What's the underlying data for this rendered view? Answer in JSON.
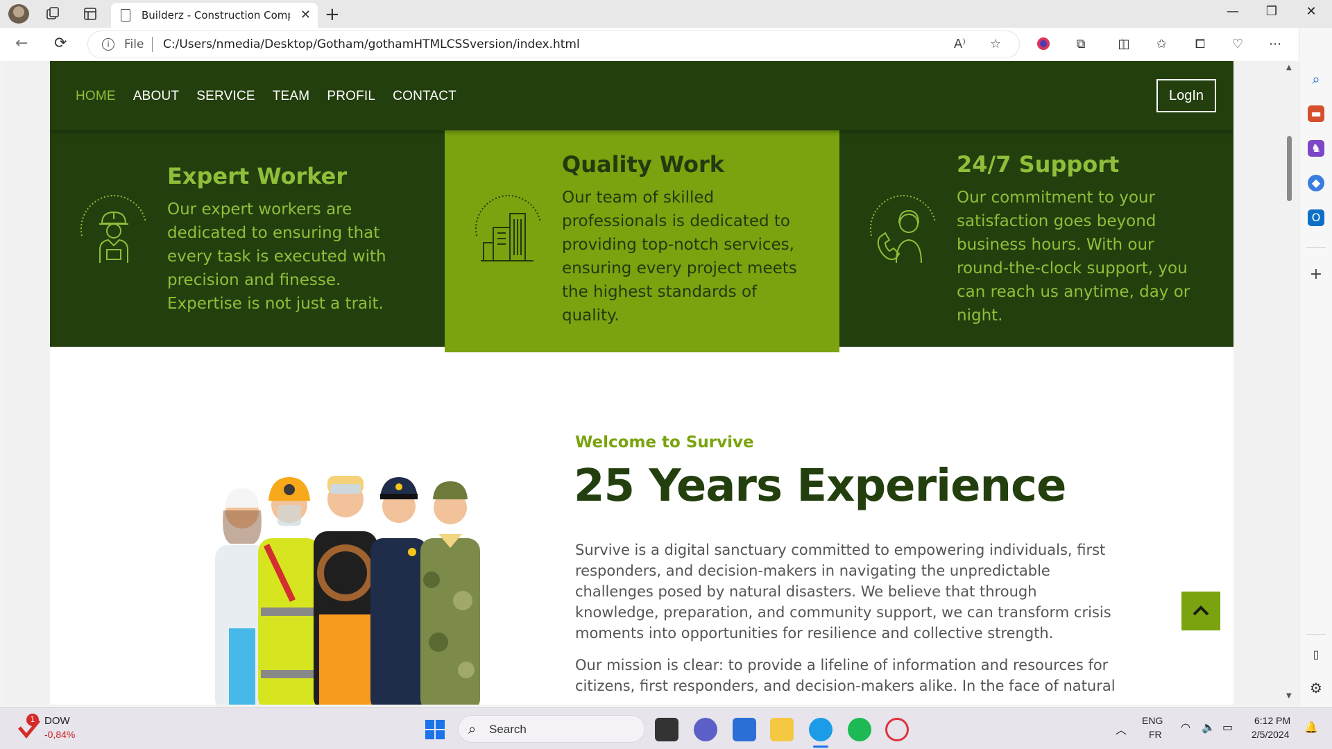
{
  "browser": {
    "tab_title": "Builderz - Construction Company",
    "url_scheme_label": "File",
    "url": "C:/Users/nmedia/Desktop/Gotham/gothamHTMLCSSversion/index.html",
    "read_aloud_label": "A⁾"
  },
  "site": {
    "nav": [
      "HOME",
      "ABOUT",
      "SERVICE",
      "TEAM",
      "PROFIL",
      "CONTACT"
    ],
    "active_nav": "HOME",
    "login_label": "LogIn",
    "features": [
      {
        "title": "Expert Worker",
        "text": "Our expert workers are dedicated to ensuring that every task is executed with precision and finesse. Expertise is not just a trait.",
        "icon": "construction-worker-icon"
      },
      {
        "title": "Quality Work",
        "text": "Our team of skilled professionals is dedicated to providing top-notch services, ensuring every project meets the highest standards of quality.",
        "icon": "buildings-icon"
      },
      {
        "title": "24/7 Support",
        "text": "Our commitment to your satisfaction goes beyond business hours. With our round-the-clock support, you can reach us anytime, day or night.",
        "icon": "support-agent-icon"
      }
    ],
    "about": {
      "subtitle": "Welcome to Survive",
      "title": "25 Years Experience",
      "paragraph1": "Survive is a digital sanctuary committed to empowering individuals, first responders, and decision-makers in navigating the unpredictable challenges posed by natural disasters. We believe that through knowledge, preparation, and community support, we can transform crisis moments into opportunities for resilience and collective strength.",
      "paragraph2": "Our mission is clear: to provide a lifeline of information and resources for citizens, first responders, and decision-makers alike. In the face of natural"
    },
    "colors": {
      "dark_green": "#233f0e",
      "accent_green": "#7aa30f",
      "light_green_text": "#8fbf3a"
    }
  },
  "taskbar": {
    "stock_name": "DOW",
    "stock_value": "-0,84%",
    "stock_badge": "1",
    "search_label": "Search",
    "lang_top": "ENG",
    "lang_bottom": "FR",
    "time": "6:12 PM",
    "date": "2/5/2024"
  }
}
